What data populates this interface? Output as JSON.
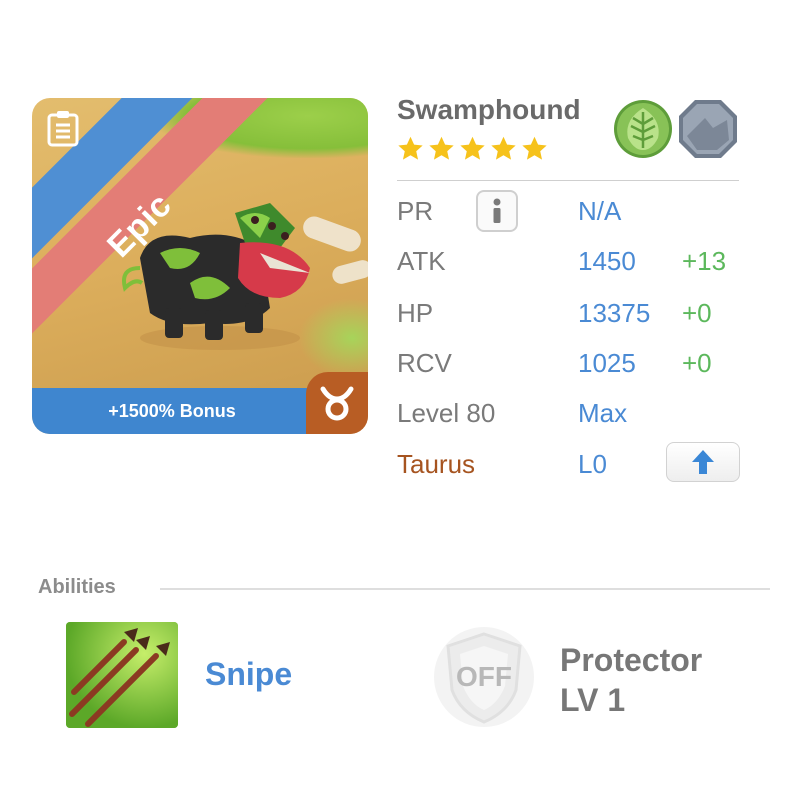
{
  "card": {
    "rarity": "Epic",
    "bonus": "+1500% Bonus",
    "rarity_icon": "clipboard-icon",
    "zodiac_icon": "taurus-icon"
  },
  "header": {
    "name": "Swamphound",
    "stars": 5,
    "elements": [
      "leaf-element-icon",
      "rock-element-icon"
    ]
  },
  "stats": {
    "pr": {
      "label": "PR",
      "value": "N/A"
    },
    "atk": {
      "label": "ATK",
      "value": "1450",
      "bonus": "+13"
    },
    "hp": {
      "label": "HP",
      "value": "13375",
      "bonus": "+0"
    },
    "rcv": {
      "label": "RCV",
      "value": "1025",
      "bonus": "+0"
    },
    "level": {
      "label": "Level 80",
      "value": "Max"
    },
    "zodiac": {
      "label": "Taurus",
      "value": "L0"
    }
  },
  "abilities": {
    "title": "Abilities",
    "active": {
      "name": "Snipe"
    },
    "passive": {
      "badge": "OFF",
      "name": "Protector",
      "level": "LV 1"
    }
  },
  "colors": {
    "value_blue": "#4a8ad4",
    "bonus_green": "#5cb85c",
    "zodiac_brown": "#a65420",
    "epic_red": "#e37d76",
    "label_gray": "#7a7a7a"
  }
}
